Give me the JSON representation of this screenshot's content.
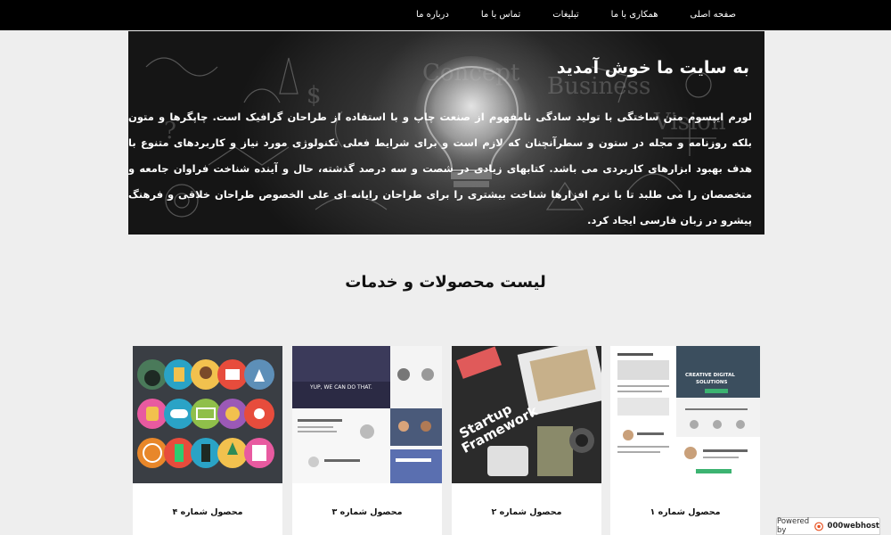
{
  "nav": {
    "items": [
      {
        "label": "صفحه اصلی"
      },
      {
        "label": "همکاری با ما"
      },
      {
        "label": "تبلیغات"
      },
      {
        "label": "تماس با ما"
      },
      {
        "label": "درباره ما"
      }
    ]
  },
  "hero": {
    "title": "به سایت ما خوش آمدید",
    "text": "لورم ایپسوم متن ساختگی با تولید سادگی نامفهوم از صنعت چاپ و با استفاده از طراحان گرافیک است. چاپگرها و متون بلکه روزنامه و مجله در ستون و سطرآنچنان که لازم است و برای شرایط فعلی تکنولوژی مورد نیاز و کاربردهای متنوع با هدف بهبود ابزارهای کاربردی می باشد. کتابهای زیادی در شصت و سه درصد گذشته، حال و آینده شناخت فراوان جامعه و متخصصان را می طلبد تا با نرم افزارها شناخت بیشتری را برای طراحان رایانه ای علی الخصوص طراحان خلاقی و فرهنگ پیشرو در زبان فارسی ایجاد کرد."
  },
  "products": {
    "title": "لیست محصولات و خدمات",
    "items": [
      {
        "label": "محصول شماره ۴"
      },
      {
        "label": "محصول شماره ۳"
      },
      {
        "label": "محصول شماره ۲"
      },
      {
        "label": "محصول شماره ۱"
      }
    ]
  },
  "badge": {
    "prefix": "Powered by",
    "brand": "000webhost"
  },
  "colors": {
    "navbar": "#000000",
    "page_background": "#eeeeee",
    "card_background": "#ffffff",
    "badge_accent": "#e8501f"
  }
}
